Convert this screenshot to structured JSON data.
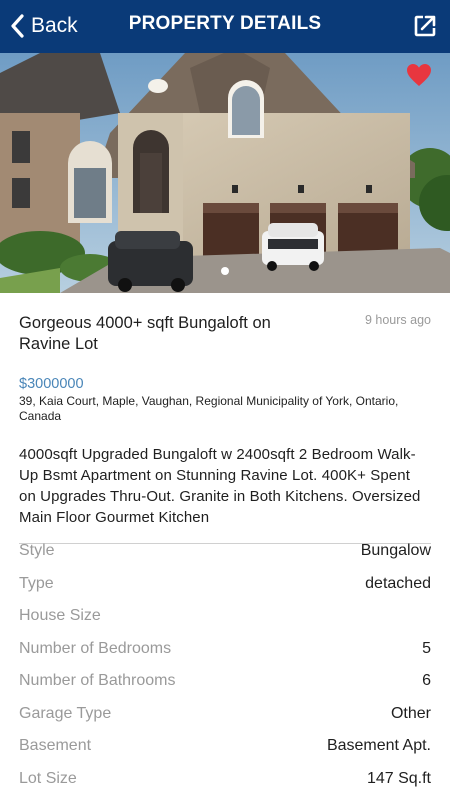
{
  "nav": {
    "back_label": "Back",
    "title": "PROPERTY DETAILS",
    "back_icon": "chevron-left-icon",
    "share_icon": "external-link-icon"
  },
  "hero": {
    "favorite_icon": "heart-icon",
    "favorite_color": "#e8363f",
    "page_indicator": {
      "current": 1,
      "total": 1
    }
  },
  "listing": {
    "title": "Gorgeous 4000+ sqft Bungaloft on Ravine Lot",
    "posted": "9 hours ago",
    "price": "$3000000",
    "address": "39, Kaia Court, Maple, Vaughan, Regional Municipality of York, Ontario, Canada",
    "description": "4000sqft Upgraded Bungaloft w 2400sqft 2 Bedroom Walk-Up Bsmt Apartment on Stunning Ravine Lot. 400K+ Spent on Upgrades Thru-Out. Granite in Both Kitchens. Oversized Main Floor Gourmet Kitchen"
  },
  "details": [
    {
      "label": "Style",
      "value": "Bungalow"
    },
    {
      "label": "Type",
      "value": "detached"
    },
    {
      "label": "House Size",
      "value": ""
    },
    {
      "label": "Number of Bedrooms",
      "value": "5"
    },
    {
      "label": "Number of Bathrooms",
      "value": "6"
    },
    {
      "label": "Garage Type",
      "value": "Other"
    },
    {
      "label": "Basement",
      "value": "Basement Apt."
    },
    {
      "label": "Lot Size",
      "value": "147 Sq.ft"
    }
  ],
  "colors": {
    "navbar": "#0a3a78",
    "price": "#4a86b8",
    "label": "#9a9a9a"
  }
}
